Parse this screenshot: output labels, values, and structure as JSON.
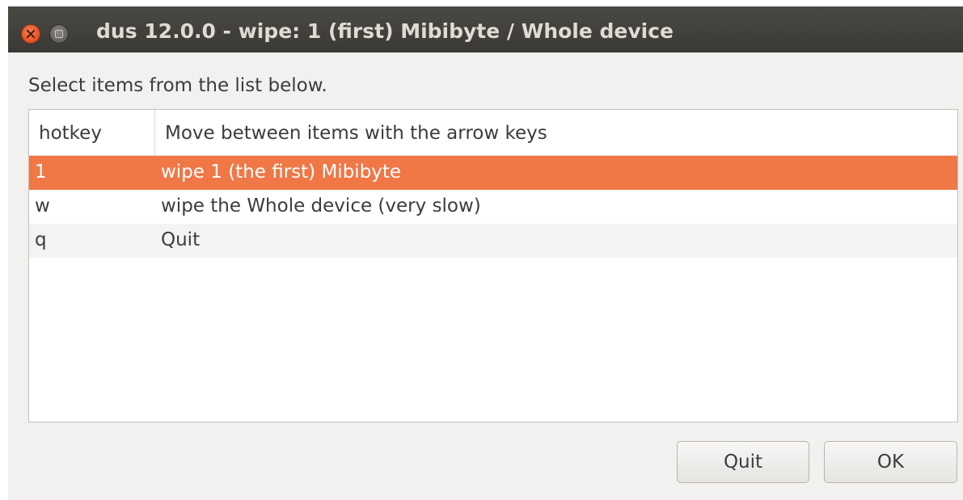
{
  "window": {
    "title": "dus 12.0.0 - wipe: 1 (first) Mibibyte / Whole device"
  },
  "prompt": "Select items from the list below.",
  "list": {
    "columns": [
      "hotkey",
      "Move between items with the arrow keys"
    ],
    "rows": [
      {
        "hotkey": "1",
        "description": "wipe 1 (the first) Mibibyte",
        "selected": true
      },
      {
        "hotkey": "w",
        "description": "wipe the Whole device (very slow)",
        "selected": false
      },
      {
        "hotkey": "q",
        "description": "Quit",
        "selected": false
      }
    ]
  },
  "buttons": {
    "quit_label": "Quit",
    "ok_label": "OK"
  },
  "colors": {
    "selection": "#f07746",
    "titlebar": "#3c3b37",
    "close_button": "#e95420"
  },
  "icons": [
    "close-icon",
    "minimize-icon"
  ]
}
